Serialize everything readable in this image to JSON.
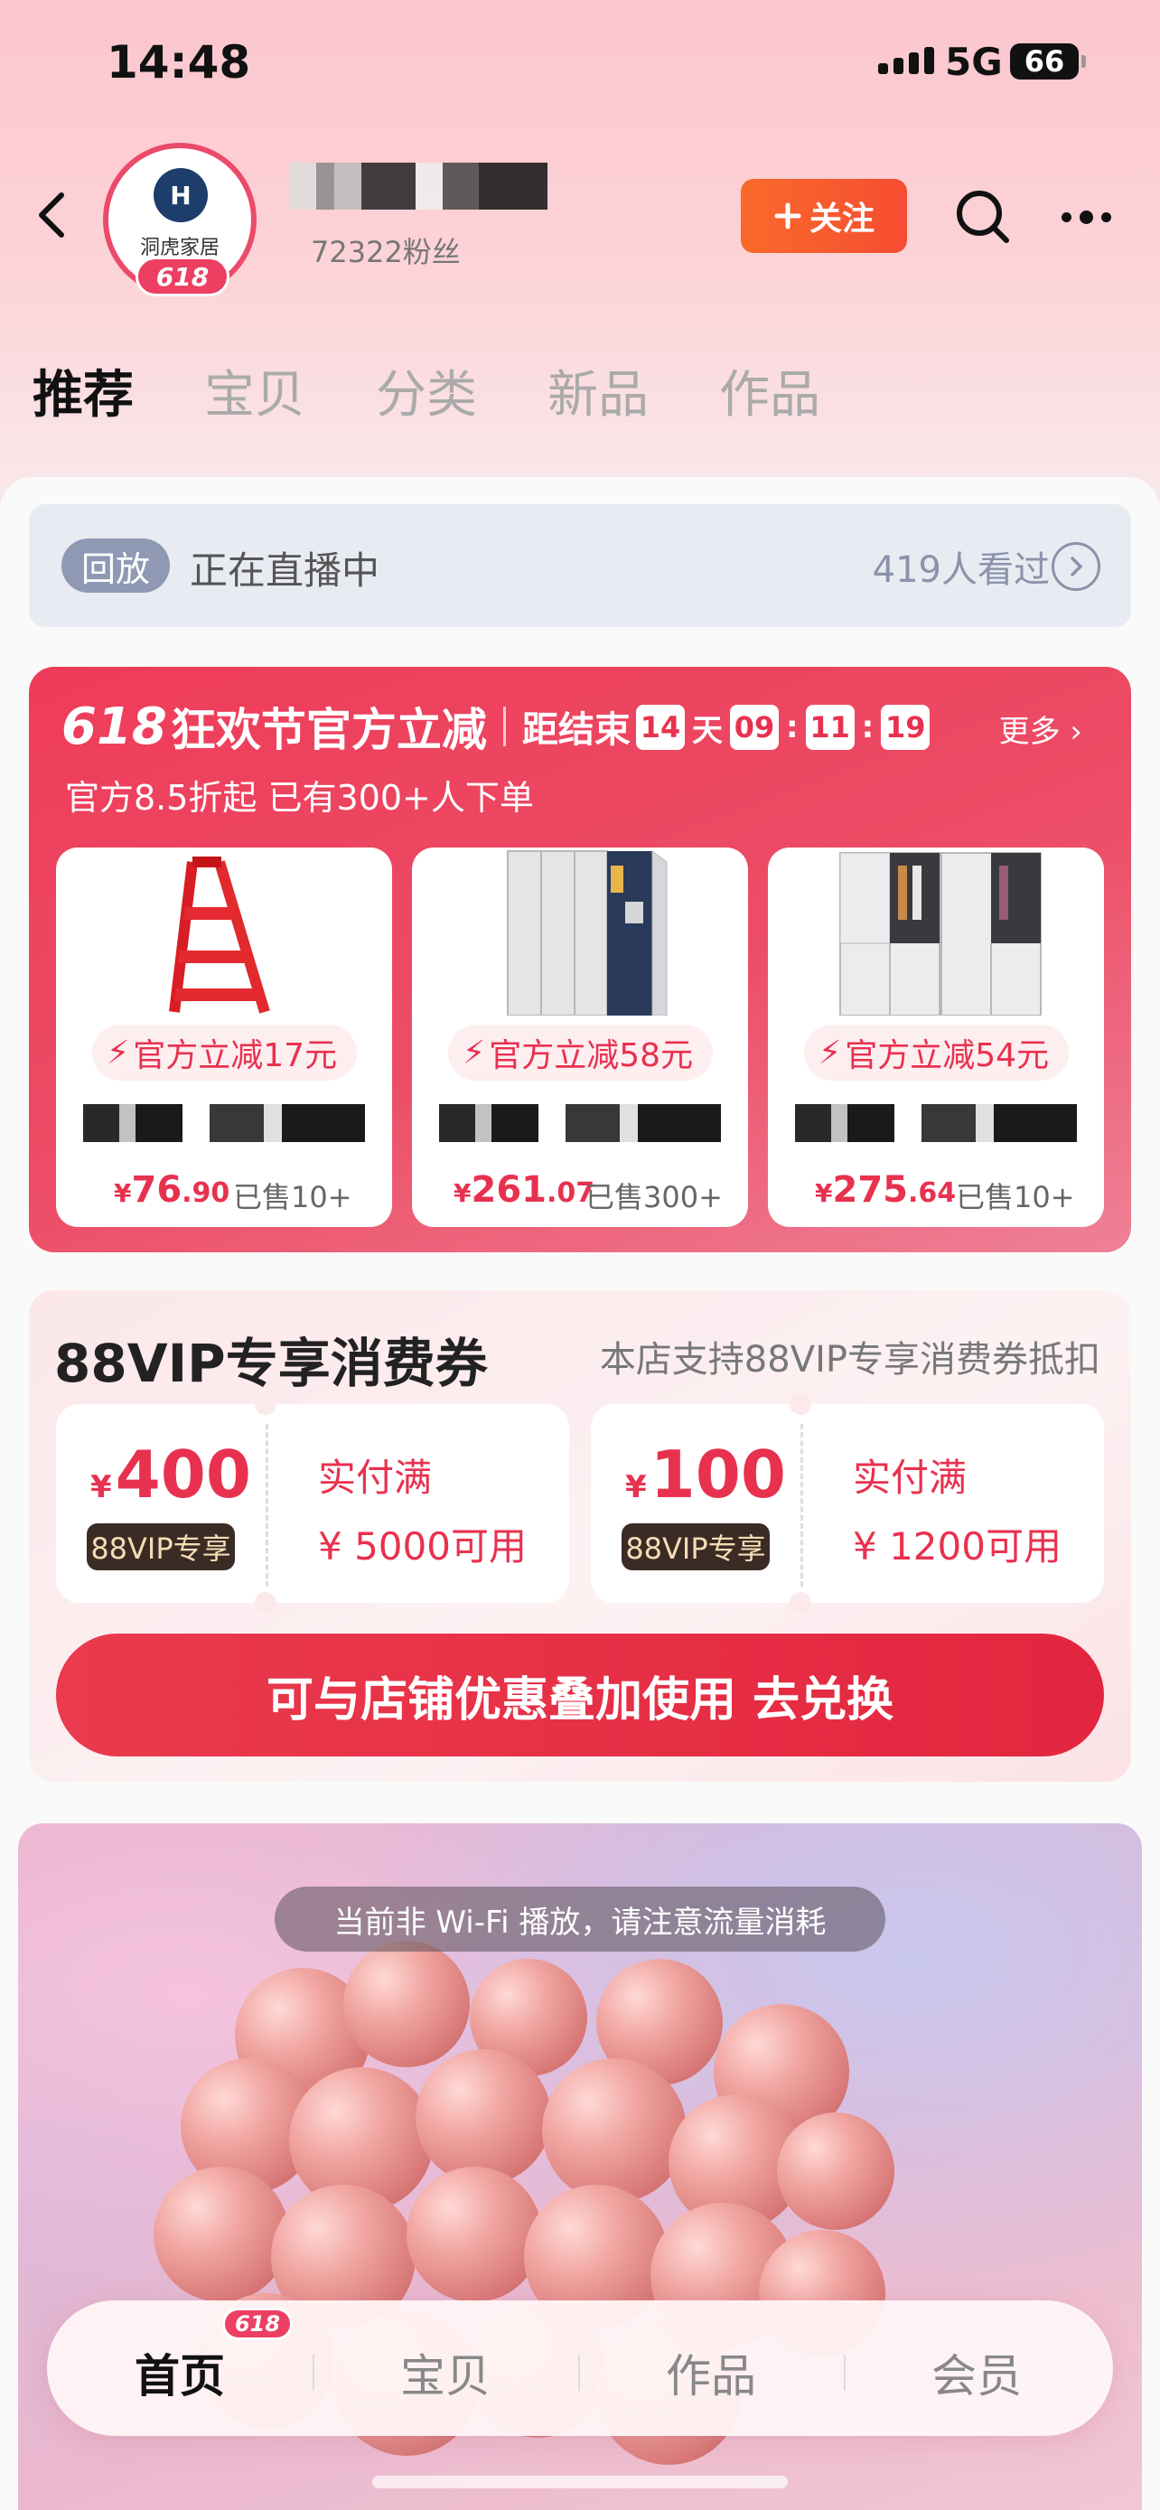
{
  "status_bar": {
    "time": "14:48",
    "network": "5G",
    "battery": "66"
  },
  "header": {
    "avatar_brand": "洞虎家居",
    "avatar_badge": "618",
    "fans": "72322粉丝",
    "follow_label": "关注",
    "follow_color": "#f55a30"
  },
  "tabs": [
    {
      "label": "推荐",
      "active": true
    },
    {
      "label": "宝贝"
    },
    {
      "label": "分类"
    },
    {
      "label": "新品"
    },
    {
      "label": "作品"
    }
  ],
  "live": {
    "tag": "回放",
    "status": "正在直播中",
    "viewers": "419人看过"
  },
  "promo": {
    "title_618": "618",
    "title": "狂欢节官方立减",
    "ends_label": "距结束",
    "countdown": {
      "days": "14",
      "day_unit": "天",
      "hours": "09",
      "minutes": "11",
      "seconds": "19"
    },
    "more_label": "更多",
    "subtitle": "官方8.5折起 已有300+人下单",
    "accent_color": "#e8314f",
    "products": [
      {
        "discount": "官方立减17元",
        "price_int": "76",
        "price_dec": ".90",
        "sold": "已售10+",
        "image": "red-step-ladder"
      },
      {
        "discount": "官方立减58元",
        "price_int": "261",
        "price_dec": ".07",
        "sold": "已售300+",
        "image": "grey-metal-locker"
      },
      {
        "discount": "官方立减54元",
        "price_int": "275",
        "price_dec": ".64",
        "sold": "已售10+",
        "image": "grey-wardrobe-locker"
      }
    ]
  },
  "vip": {
    "title": "88VIP专享消费券",
    "note": "本店支持88VIP专享消费券抵扣",
    "coupons": [
      {
        "amount": "400",
        "badge": "88VIP专享",
        "condition": "实付满",
        "threshold": "¥ 5000可用"
      },
      {
        "amount": "100",
        "badge": "88VIP专享",
        "condition": "实付满",
        "threshold": "¥ 1200可用"
      }
    ],
    "button_label": "可与店铺优惠叠加使用 去兑换"
  },
  "video": {
    "wifi_tip": "当前非 Wi-Fi 播放，请注意流量消耗"
  },
  "bottom_nav": {
    "badge": "618",
    "items": [
      {
        "label": "首页",
        "active": true
      },
      {
        "label": "宝贝"
      },
      {
        "label": "作品"
      },
      {
        "label": "会员"
      }
    ]
  }
}
